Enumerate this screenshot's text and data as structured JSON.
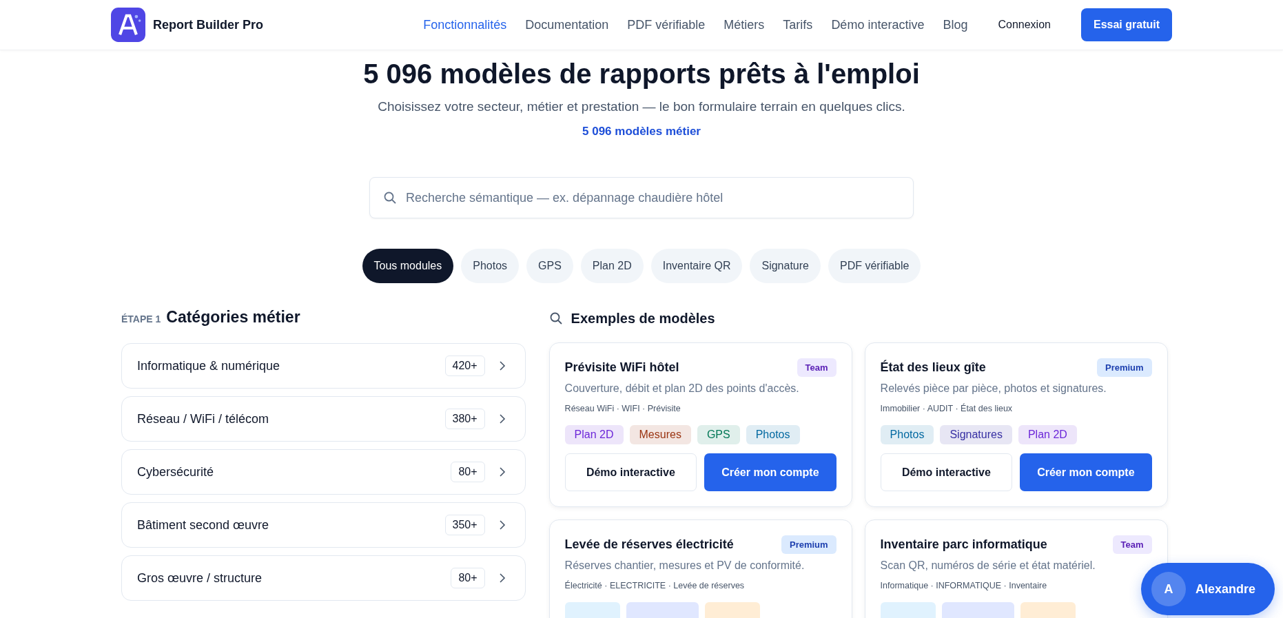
{
  "header": {
    "brand": "Report Builder Pro",
    "nav": [
      {
        "label": "Fonctionnalités",
        "selected": true
      },
      {
        "label": "Documentation",
        "selected": false
      },
      {
        "label": "PDF vérifiable",
        "selected": false
      },
      {
        "label": "Métiers",
        "selected": false
      },
      {
        "label": "Tarifs",
        "selected": false
      },
      {
        "label": "Démo interactive",
        "selected": false
      },
      {
        "label": "Blog",
        "selected": false
      }
    ],
    "login": "Connexion",
    "cta": "Essai gratuit"
  },
  "hero": {
    "title": "5 096 modèles de rapports prêts à l'emploi",
    "subtitle": "Choisissez votre secteur, métier et prestation — le bon formulaire terrain en quelques clics.",
    "count_link": "5 096 modèles métier"
  },
  "search": {
    "placeholder": "Recherche sémantique — ex. dépannage chaudière hôtel"
  },
  "filters": [
    {
      "label": "Tous modules",
      "selected": true
    },
    {
      "label": "Photos",
      "selected": false
    },
    {
      "label": "GPS",
      "selected": false
    },
    {
      "label": "Plan 2D",
      "selected": false
    },
    {
      "label": "Inventaire QR",
      "selected": false
    },
    {
      "label": "Signature",
      "selected": false
    },
    {
      "label": "PDF vérifiable",
      "selected": false
    }
  ],
  "categories": {
    "step": "ÉTAPE 1",
    "title": "Catégories métier",
    "items": [
      {
        "name": "Informatique & numérique",
        "count": "420+"
      },
      {
        "name": "Réseau / WiFi / télécom",
        "count": "380+"
      },
      {
        "name": "Cybersécurité",
        "count": "80+"
      },
      {
        "name": "Bâtiment second œuvre",
        "count": "350+"
      },
      {
        "name": "Gros œuvre / structure",
        "count": "80+"
      }
    ]
  },
  "examples": {
    "title": "Exemples de modèles",
    "cards": [
      {
        "title": "Prévisite WiFi hôtel",
        "plan": {
          "kind": "team",
          "label": "Team"
        },
        "description": "Couverture, débit et plan 2D des points d'accès.",
        "meta": "Réseau WiFi · WIFI · Prévisite",
        "tags": [
          {
            "label": "Plan 2D",
            "color": "#6d28d9"
          },
          {
            "label": "Mesures",
            "color": "#9a3412"
          },
          {
            "label": "GPS",
            "color": "#047857"
          },
          {
            "label": "Photos",
            "color": "#0369a1"
          }
        ],
        "secondary": "Démo interactive",
        "primary": "Créer mon compte"
      },
      {
        "title": "État des lieux gîte",
        "plan": {
          "kind": "premium",
          "label": "Premium"
        },
        "description": "Relevés pièce par pièce, photos et signatures.",
        "meta": "Immobilier · AUDIT · État des lieux",
        "tags": [
          {
            "label": "Photos",
            "color": "#0369a1"
          },
          {
            "label": "Signatures",
            "color": "#3730a3"
          },
          {
            "label": "Plan 2D",
            "color": "#6d28d9"
          }
        ],
        "secondary": "Démo interactive",
        "primary": "Créer mon compte"
      },
      {
        "title": "Levée de réserves électricité",
        "plan": {
          "kind": "premium",
          "label": "Premium"
        },
        "description": "Réserves chantier, mesures et PV de conformité.",
        "meta": "Électricité · ELECTRICITE · Levée de réserves"
      },
      {
        "title": "Inventaire parc informatique",
        "plan": {
          "kind": "team",
          "label": "Team"
        },
        "description": "Scan QR, numéros de série et état matériel.",
        "meta": "Informatique · INFORMATIQUE · Inventaire"
      }
    ]
  },
  "user": {
    "initial": "A",
    "name": "Alexandre"
  }
}
